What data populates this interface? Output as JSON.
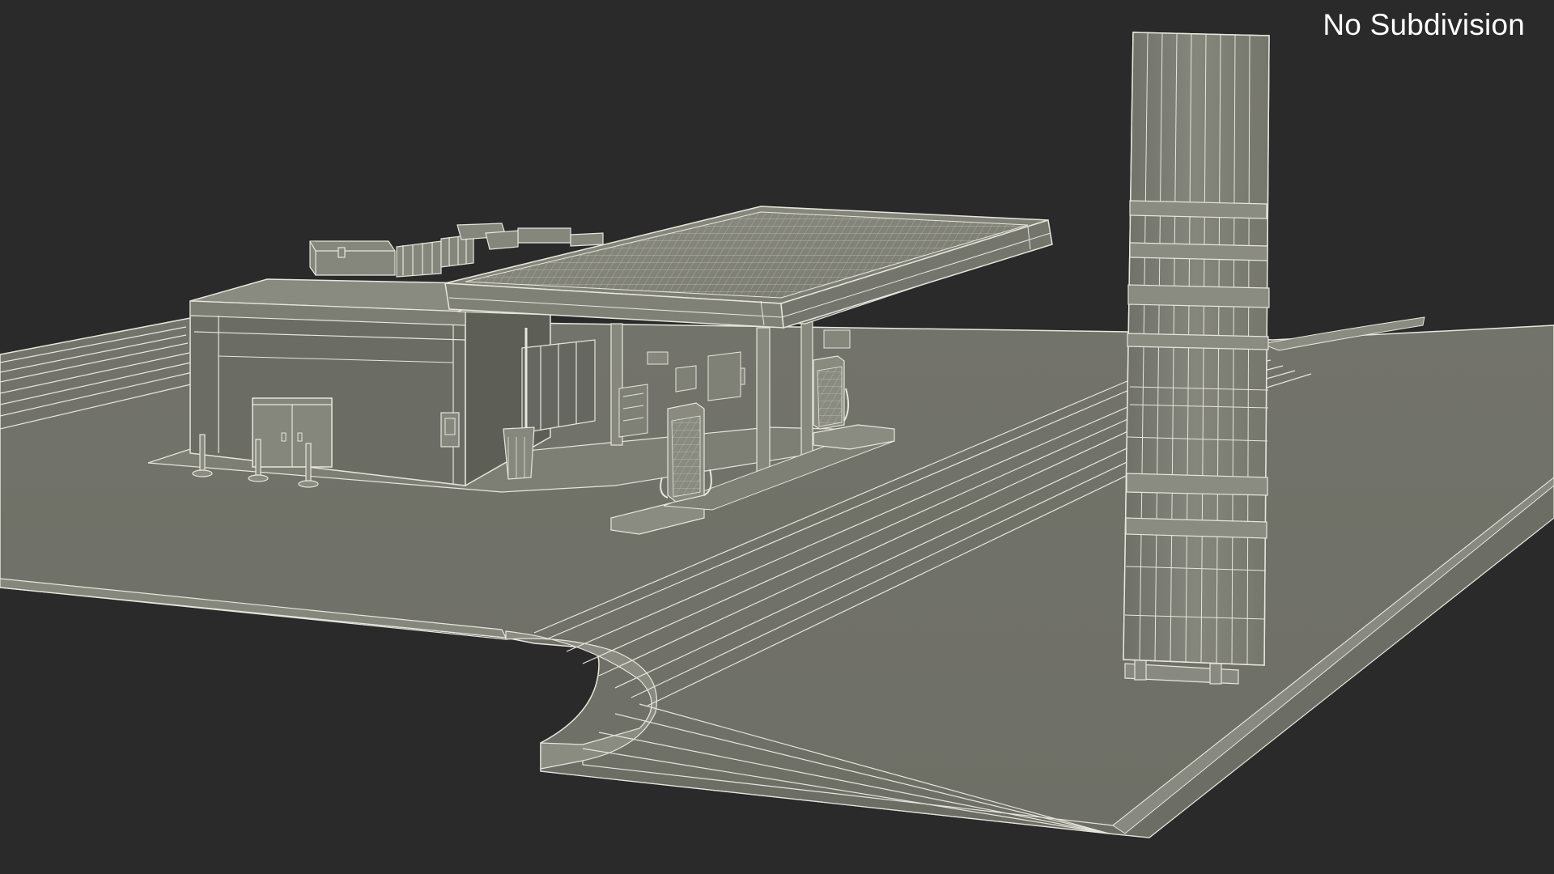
{
  "overlay": {
    "label": "No Subdivision"
  },
  "colors": {
    "background": "#2a2a2a",
    "surface": "#74756a",
    "surface_light": "#8a8b80",
    "surface_dark": "#5c5d54",
    "wire": "#e6e6dc"
  }
}
